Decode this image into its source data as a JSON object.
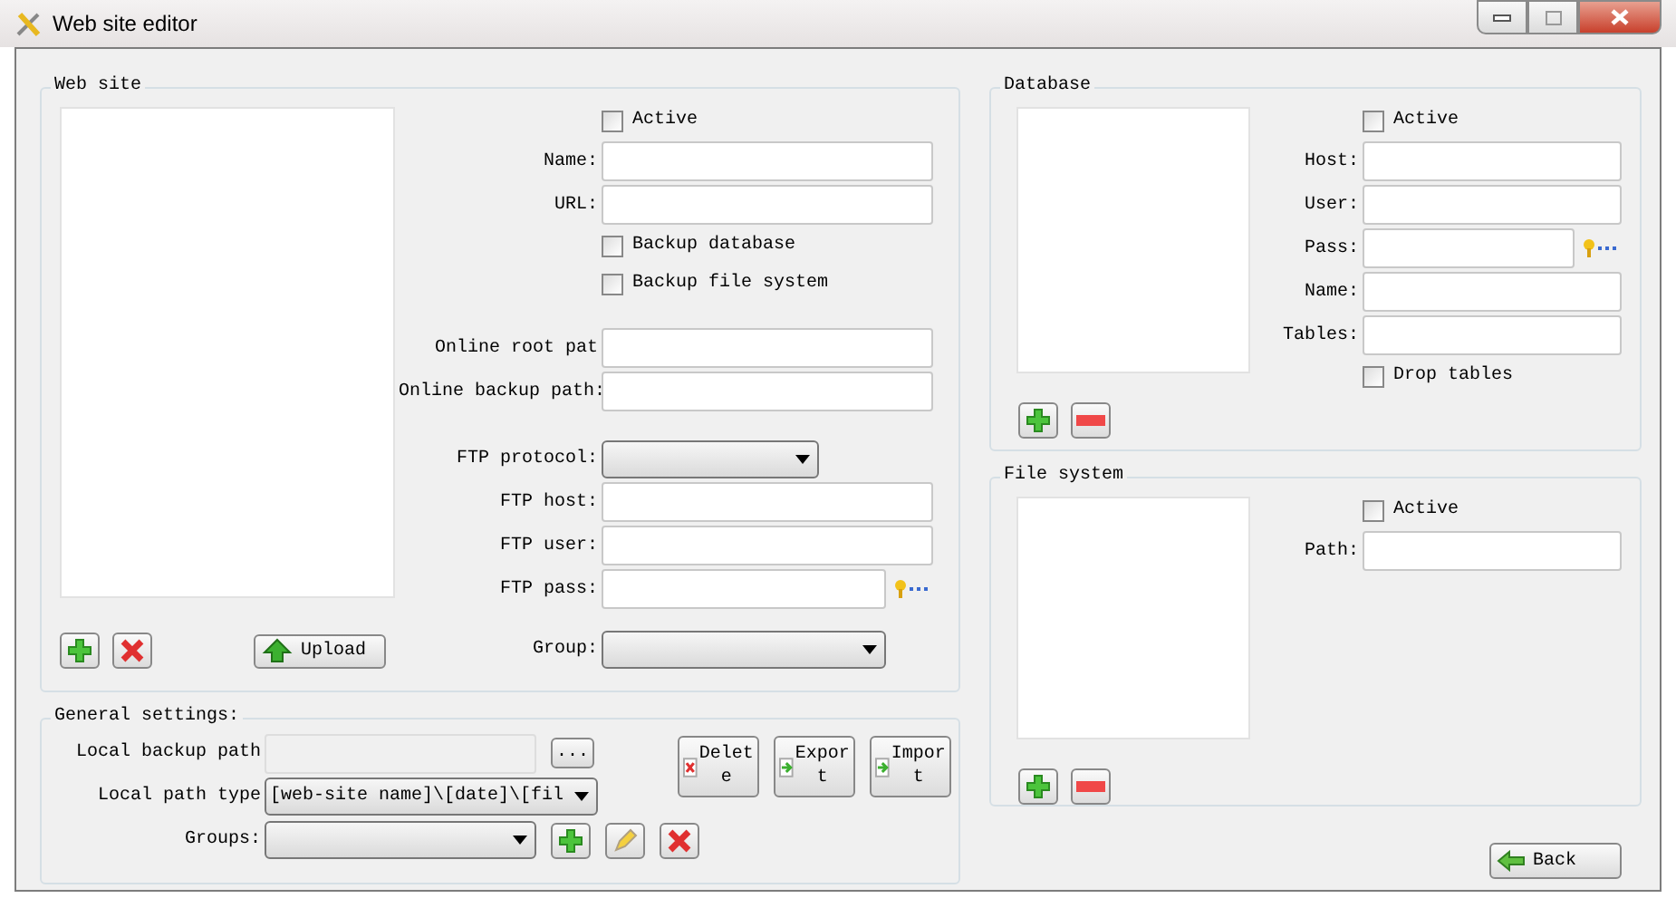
{
  "window": {
    "title": "Web site editor"
  },
  "web_site": {
    "title": "Web site",
    "field_groups": [
      [
        {
          "kind": "checkbox",
          "label": "Active",
          "checked": false
        },
        {
          "kind": "text",
          "label": "Name:"
        },
        {
          "kind": "text",
          "label": "URL:"
        },
        {
          "kind": "checkbox",
          "label": "Backup database",
          "checked": false
        },
        {
          "kind": "checkbox",
          "label": "Backup file system",
          "checked": false
        }
      ],
      [
        {
          "kind": "text",
          "label": "Online root pat"
        },
        {
          "kind": "text",
          "label": "Online backup path:"
        }
      ],
      [
        {
          "kind": "select",
          "label": "FTP protocol:"
        },
        {
          "kind": "text",
          "label": "FTP host:"
        },
        {
          "kind": "text",
          "label": "FTP user:"
        },
        {
          "kind": "password",
          "label": "FTP pass:"
        }
      ],
      [
        {
          "kind": "select",
          "label": "Group:"
        }
      ]
    ],
    "list_buttons": [
      {
        "kind": "add"
      },
      {
        "kind": "delete"
      }
    ],
    "upload_button": "Upload"
  },
  "general_settings": {
    "title": "General settings:",
    "rows": [
      {
        "kind": "path",
        "label": "Local backup path",
        "button": "..."
      },
      {
        "kind": "select",
        "label": "Local path type",
        "value": "[web-site name]\\[date]\\[fil"
      },
      {
        "kind": "groups",
        "label": "Groups:"
      }
    ],
    "buttons": [
      {
        "kind": "delete",
        "label": "Delete"
      },
      {
        "kind": "export",
        "label": "Export"
      },
      {
        "kind": "import",
        "label": "Import"
      }
    ]
  },
  "database": {
    "title": "Database",
    "rows": [
      {
        "kind": "checkbox",
        "label": "Active",
        "checked": false
      },
      {
        "kind": "text",
        "label": "Host:"
      },
      {
        "kind": "text",
        "label": "User:"
      },
      {
        "kind": "password",
        "label": "Pass:"
      },
      {
        "kind": "text",
        "label": "Name:"
      },
      {
        "kind": "text",
        "label": "Tables:"
      },
      {
        "kind": "checkbox",
        "label": "Drop tables",
        "checked": false
      }
    ],
    "list_buttons": [
      {
        "kind": "add"
      },
      {
        "kind": "remove"
      }
    ]
  },
  "file_system": {
    "title": "File system",
    "rows": [
      {
        "kind": "checkbox",
        "label": "Active",
        "checked": false
      },
      {
        "kind": "text",
        "label": "Path:"
      }
    ],
    "list_buttons": [
      {
        "kind": "add"
      },
      {
        "kind": "remove"
      }
    ]
  },
  "back_button": "Back"
}
